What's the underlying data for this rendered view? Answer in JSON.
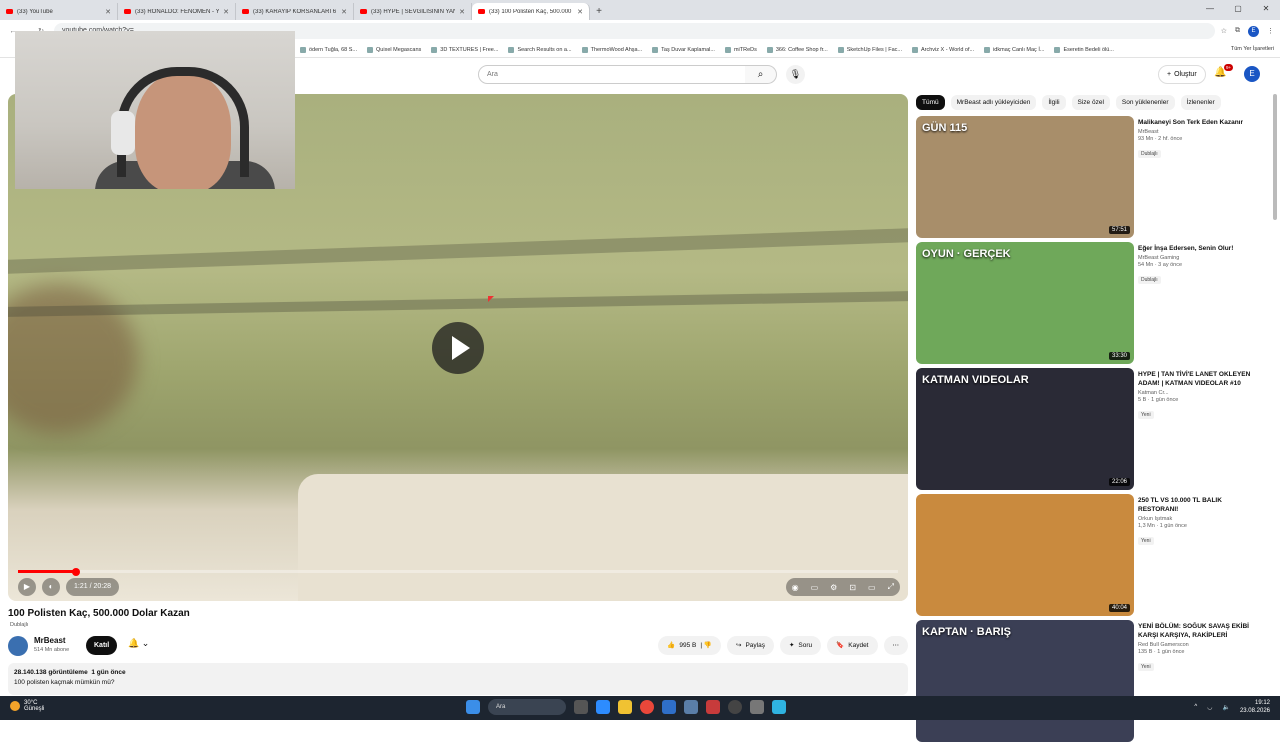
{
  "browser": {
    "tabs": [
      {
        "title": "(33) YouTube",
        "active": false
      },
      {
        "title": "(33) RONALDO: FENOMEN - Yo",
        "active": false
      },
      {
        "title": "(33) KARAYİP KORSANLARI 6 ",
        "active": false
      },
      {
        "title": "(33) HYPE | SEVGİLİSİNİN YANİ",
        "active": false
      },
      {
        "title": "(33) 100 Polisten Kaç, 500.000 ",
        "active": true
      }
    ],
    "url": "youtube.com/watch?v=…",
    "bookmarks": [
      "ödern Tuğla, 68 S...",
      "Quixel Megascans",
      "3D TEXTURES | Free...",
      "Search Results on a...",
      "ThermoWood Ahşa...",
      "Taş Duvar Kaplamal...",
      "miTReDs",
      "366: Coffee Shop fr...",
      "SketchUp Files | Fac...",
      "Archviz X - World of...",
      "idkmaç Canlı Maç İ...",
      "Eseretin Bedeli ölü..."
    ],
    "bookmarks_right": "Tüm Yer İşaretleri",
    "profile_letter": "E"
  },
  "youtube": {
    "search_placeholder": "Ara",
    "create_label": "Oluştur",
    "notif_count": "9+",
    "avatar_letter": "E"
  },
  "player": {
    "current_time": "1:21",
    "duration": "20:28",
    "progress_fraction": 0.066,
    "time_display": "1:21 / 20:28"
  },
  "video": {
    "title": "100 Polisten Kaç, 500.000 Dolar Kazan",
    "dubbed": "Dublajlı",
    "channel": "MrBeast",
    "subscribers": "514 Mn abone",
    "join_label": "Katıl",
    "likes": "995 B",
    "share_label": "Paylaş",
    "ask_label": "Soru",
    "save_label": "Kaydet",
    "views": "28.140.138 görüntüleme",
    "age": "1 gün önce",
    "description": "100 polisten kaçmak mümkün mü?"
  },
  "chips": [
    "Tümü",
    "MrBeast adlı yükleyiciden",
    "İlgili",
    "Size özel",
    "Son yüklenenler",
    "İzlenenler"
  ],
  "recommendations": [
    {
      "title": "Malikaneyi Son Terk Eden Kazanır",
      "channel": "MrBeast",
      "meta": "93 Mn · 2 hf. önce",
      "tag": "Dublajlı",
      "duration": "57:51",
      "overlay": "GÜN 115",
      "bg": "#a88e6a"
    },
    {
      "title": "Eğer İnşa Edersen, Senin Olur!",
      "channel": "MrBeast Gaming",
      "meta": "54 Mn · 3 ay önce",
      "tag": "Dublajlı",
      "duration": "33:30",
      "overlay": "OYUN · GERÇEK",
      "bg": "#6fa85a"
    },
    {
      "title": "HYPE | TAN TİVİ'E LANET OKLEYEN ADAM! | KATMAN VIDEOLAR #10",
      "channel": "Katman Cr...",
      "meta": "5 B · 1 gün önce",
      "tag": "Yeni",
      "duration": "22:06",
      "overlay": "KATMAN VIDEOLAR",
      "bg": "#2a2a36"
    },
    {
      "title": "250 TL VS 10.000 TL BALIK RESTORANI!",
      "channel": "Orkun Işıtmak",
      "meta": "1,3 Mn · 1 gün önce",
      "tag": "Yeni",
      "duration": "40:04",
      "overlay": "",
      "bg": "#c98a3e"
    },
    {
      "title": "YENİ BÖLÜM: SOĞUK SAVAŞ EKİBİ KARŞI KARŞIYA, RAKİPLERİ LATENIGHTER",
      "channel": "Red Bull Gamerscon",
      "meta": "135 B · 1 gün önce",
      "tag": "Yeni",
      "duration": "",
      "overlay": "KAPTAN · BARIŞ",
      "bg": "#3b3f55"
    }
  ],
  "taskbar": {
    "temp": "30°C",
    "weather": "Güneşli",
    "search": "Ara",
    "time": "19:12",
    "date": "23.08.2026"
  }
}
